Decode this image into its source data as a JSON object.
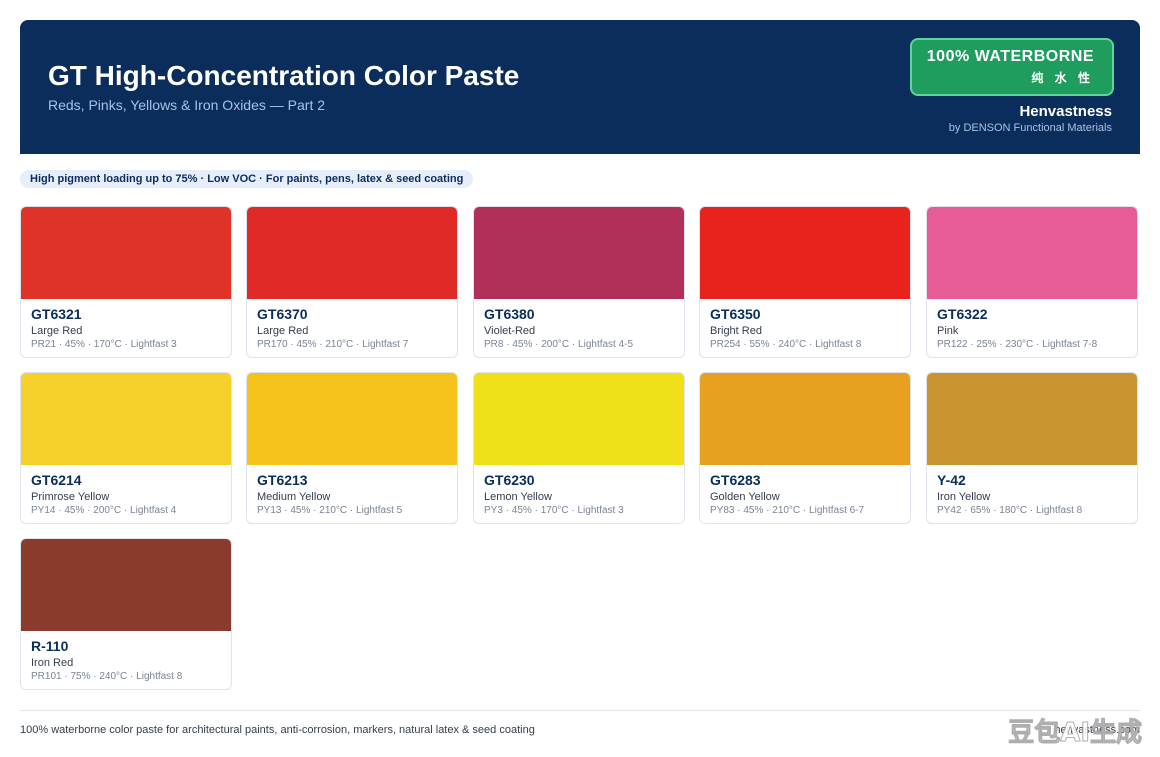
{
  "header": {
    "title": "GT High-Concentration Color Paste",
    "subtitle": "Reds, Pinks, Yellows & Iron Oxides — Part 2",
    "badge_main": "100% WATERBORNE",
    "badge_sub": "纯 水 性",
    "brand": "Henvastness",
    "brand_sub": "by DENSON Functional Materials"
  },
  "tagline": "High pigment loading up to 75% · Low VOC · For paints, pens, latex & seed coating",
  "colors": {
    "header_bg": "#0b2d5b",
    "badge_bg": "#1f9d5f"
  },
  "products": [
    {
      "code": "GT6321",
      "name": "Large Red",
      "spec": "PR21 · 45% · 170°C · Lightfast 3",
      "color": "#e03328"
    },
    {
      "code": "GT6370",
      "name": "Large Red",
      "spec": "PR170 · 45% · 210°C · Lightfast 7",
      "color": "#e02a28"
    },
    {
      "code": "GT6380",
      "name": "Violet-Red",
      "spec": "PR8 · 45% · 200°C · Lightfast 4-5",
      "color": "#b0305a"
    },
    {
      "code": "GT6350",
      "name": "Bright Red",
      "spec": "PR254 · 55% · 240°C · Lightfast 8",
      "color": "#e8221c"
    },
    {
      "code": "GT6322",
      "name": "Pink",
      "spec": "PR122 · 25% · 230°C · Lightfast 7-8",
      "color": "#e85c96"
    },
    {
      "code": "GT6214",
      "name": "Primrose Yellow",
      "spec": "PY14 · 45% · 200°C · Lightfast 4",
      "color": "#f6d02a"
    },
    {
      "code": "GT6213",
      "name": "Medium Yellow",
      "spec": "PY13 · 45% · 210°C · Lightfast 5",
      "color": "#f4c21a"
    },
    {
      "code": "GT6230",
      "name": "Lemon Yellow",
      "spec": "PY3 · 45% · 170°C · Lightfast 3",
      "color": "#f0e01a"
    },
    {
      "code": "GT6283",
      "name": "Golden Yellow",
      "spec": "PY83 · 45% · 210°C · Lightfast 6-7",
      "color": "#e8a020"
    },
    {
      "code": "Y-42",
      "name": "Iron Yellow",
      "spec": "PY42 · 65% · 180°C · Lightfast 8",
      "color": "#c99530"
    },
    {
      "code": "R-110",
      "name": "Iron Red",
      "spec": "PR101 · 75% · 240°C · Lightfast 8",
      "color": "#8b3a2e"
    }
  ],
  "footer": {
    "left": "100% waterborne color paste for architectural paints, anti-corrosion, markers, natural latex & seed coating",
    "right": "henvastness.com"
  },
  "watermark": "豆包AI生成"
}
